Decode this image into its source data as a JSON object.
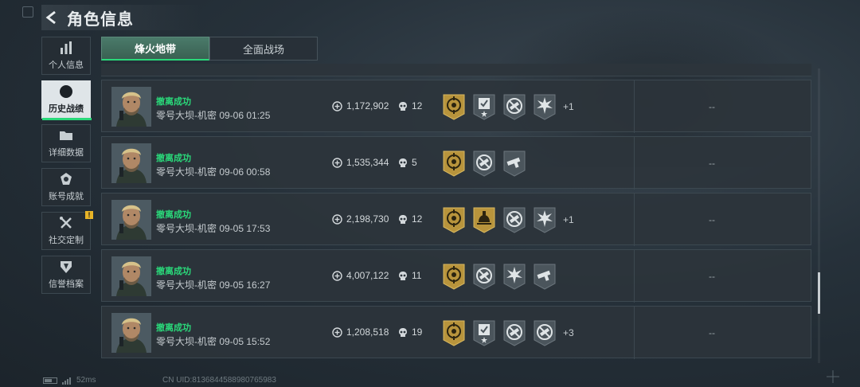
{
  "header": {
    "title": "角色信息"
  },
  "sidebar": {
    "items": [
      {
        "label": "个人信息",
        "icon": "bar-chart-icon"
      },
      {
        "label": "历史战绩",
        "icon": "clock-history-icon",
        "active": true
      },
      {
        "label": "详细数据",
        "icon": "folder-icon"
      },
      {
        "label": "账号成就",
        "icon": "achievement-icon"
      },
      {
        "label": "社交定制",
        "icon": "tools-icon",
        "badge": "!"
      },
      {
        "label": "信誉档案",
        "icon": "shield-icon"
      }
    ]
  },
  "tabs": [
    {
      "label": "烽火地带",
      "active": true
    },
    {
      "label": "全面战场"
    }
  ],
  "records": [
    {
      "status": "撤离成功",
      "map_time": "零号大坝-机密 09-06 01:25",
      "money": "1,172,902",
      "kills": "12",
      "badges": [
        "gold-crosshair-badge",
        "checklist-badge",
        "no-weapon-badge",
        "star-burst-badge"
      ],
      "more": "+1",
      "extra": "--"
    },
    {
      "status": "撤离成功",
      "map_time": "零号大坝-机密 09-06 00:58",
      "money": "1,535,344",
      "kills": "5",
      "badges": [
        "gold-crosshair-badge",
        "no-weapon-badge",
        "gun-badge"
      ],
      "more": "",
      "extra": "--"
    },
    {
      "status": "撤离成功",
      "map_time": "零号大坝-机密 09-05 17:53",
      "money": "2,198,730",
      "kills": "12",
      "badges": [
        "gold-crosshair-badge",
        "gold-helmet-badge",
        "no-weapon-badge",
        "star-burst-badge"
      ],
      "more": "+1",
      "extra": "--"
    },
    {
      "status": "撤离成功",
      "map_time": "零号大坝-机密 09-05 16:27",
      "money": "4,007,122",
      "kills": "11",
      "badges": [
        "gold-crosshair-badge",
        "no-weapon-badge",
        "star-burst-badge",
        "gun-badge"
      ],
      "more": "",
      "extra": "--"
    },
    {
      "status": "撤离成功",
      "map_time": "零号大坝-机密 09-05 15:52",
      "money": "1,208,518",
      "kills": "19",
      "badges": [
        "gold-crosshair-badge",
        "checklist-badge",
        "no-weapon-badge",
        "no-weapon-badge"
      ],
      "more": "+3",
      "extra": "--"
    }
  ],
  "footer": {
    "ping": "52ms",
    "uid": "CN UID:8136844588980765983"
  },
  "colors": {
    "accent_green": "#2ad97a",
    "gold": "#b8943c",
    "badge_gray": "#4b555c",
    "alert_yellow": "#e8b427"
  }
}
